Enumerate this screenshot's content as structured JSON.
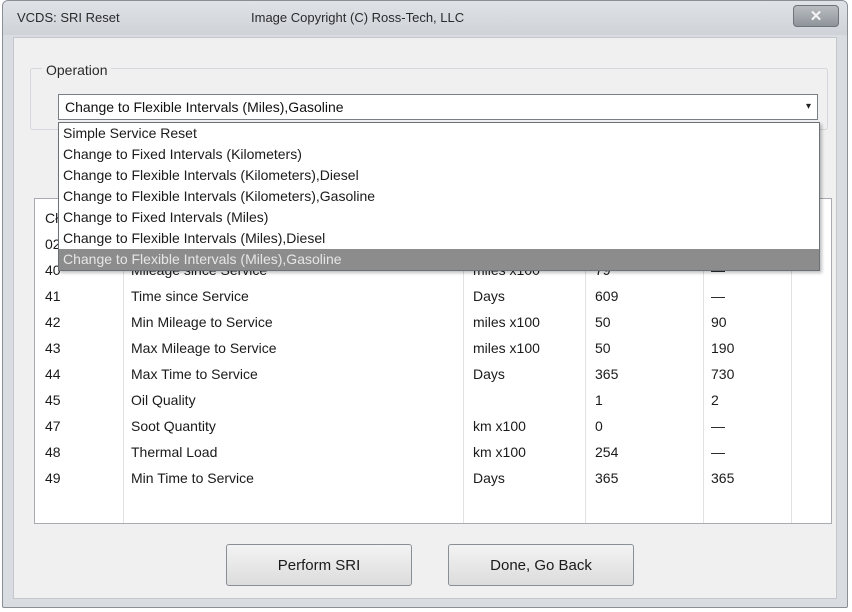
{
  "window": {
    "title": "VCDS:  SRI Reset",
    "copyright": "Image Copyright (C) Ross-Tech, LLC",
    "close_glyph": "✕"
  },
  "operation": {
    "group_label": "Operation",
    "selected": "Change to Flexible Intervals (Miles),Gasoline",
    "dropdown_open": true,
    "options": [
      "Simple Service Reset",
      "Change to Fixed Intervals (Kilometers)",
      "Change to Flexible Intervals (Kilometers),Diesel",
      "Change to Flexible Intervals (Kilometers),Gasoline",
      "Change to Fixed Intervals (Miles)",
      "Change to Flexible Intervals (Miles),Diesel",
      "Change to Flexible Intervals (Miles),Gasoline"
    ],
    "highlighted_index": 6
  },
  "table": {
    "header_partial": "Cł",
    "row_partial_channel": "02",
    "rows": [
      {
        "channel": "40",
        "name": "Mileage since Service",
        "unit": "miles x100",
        "value": "79",
        "adjust": "—"
      },
      {
        "channel": "41",
        "name": "Time since Service",
        "unit": "Days",
        "value": "609",
        "adjust": "—"
      },
      {
        "channel": "42",
        "name": "Min Mileage to Service",
        "unit": "miles x100",
        "value": "50",
        "adjust": "90"
      },
      {
        "channel": "43",
        "name": "Max Mileage to Service",
        "unit": "miles x100",
        "value": "50",
        "adjust": "190"
      },
      {
        "channel": "44",
        "name": "Max Time to Service",
        "unit": "Days",
        "value": "365",
        "adjust": "730"
      },
      {
        "channel": "45",
        "name": "Oil Quality",
        "unit": "",
        "value": "1",
        "adjust": "2"
      },
      {
        "channel": "47",
        "name": "Soot Quantity",
        "unit": "km x100",
        "value": "0",
        "adjust": "—"
      },
      {
        "channel": "48",
        "name": "Thermal Load",
        "unit": "km x100",
        "value": "254",
        "adjust": "—"
      },
      {
        "channel": "49",
        "name": "Min Time to Service",
        "unit": "Days",
        "value": "365",
        "adjust": "365"
      }
    ]
  },
  "buttons": {
    "perform": "Perform SRI",
    "done": "Done, Go Back"
  },
  "icons": {
    "dropdown_arrow": "▾"
  }
}
